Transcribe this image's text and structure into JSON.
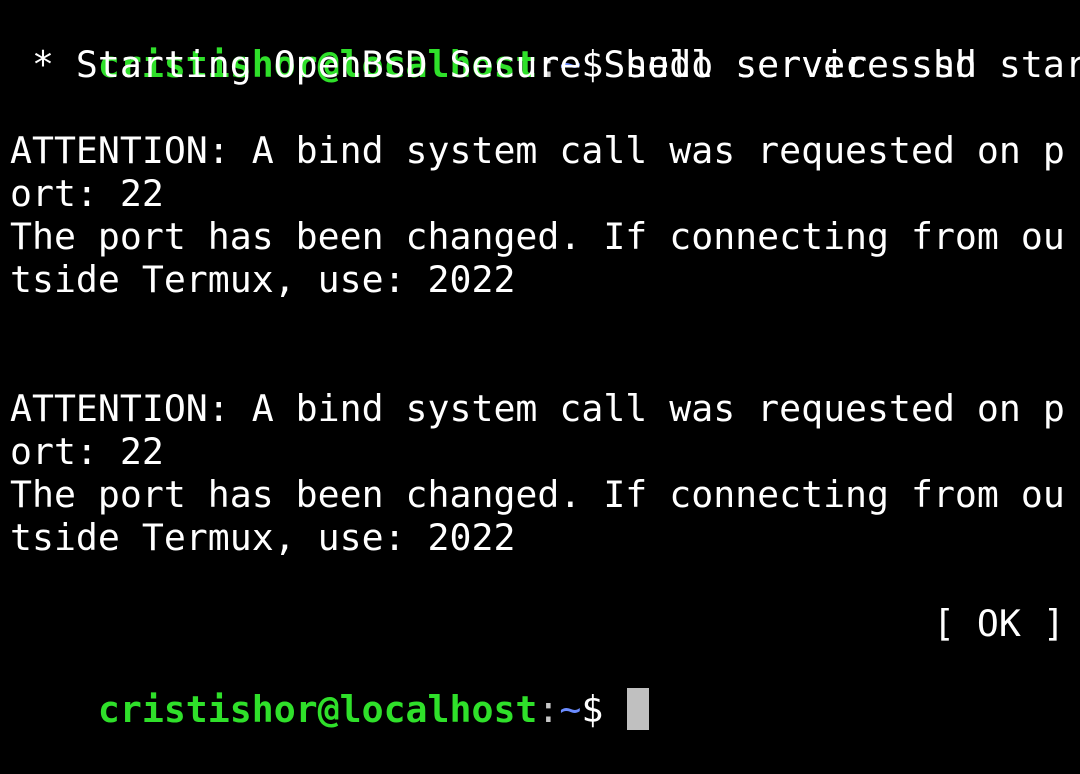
{
  "prompt": {
    "user_host": "cristishor@localhost",
    "separator": ":",
    "path": "~",
    "symbol": "$ "
  },
  "command": "sudo service ssh start",
  "output": [
    " * Starting OpenBSD Secure Shell server sshd",
    "",
    "ATTENTION: A bind system call was requested on p",
    "ort: 22",
    "The port has been changed. If connecting from ou",
    "tside Termux, use: 2022",
    "",
    "",
    "ATTENTION: A bind system call was requested on p",
    "ort: 22",
    "The port has been changed. If connecting from ou",
    "tside Termux, use: 2022",
    "",
    "                                          [ OK ]"
  ],
  "colors": {
    "background": "#000000",
    "prompt_user": "#2fe02a",
    "prompt_path": "#6b8cff",
    "text": "#ffffff",
    "cursor": "#c0c0c0"
  }
}
